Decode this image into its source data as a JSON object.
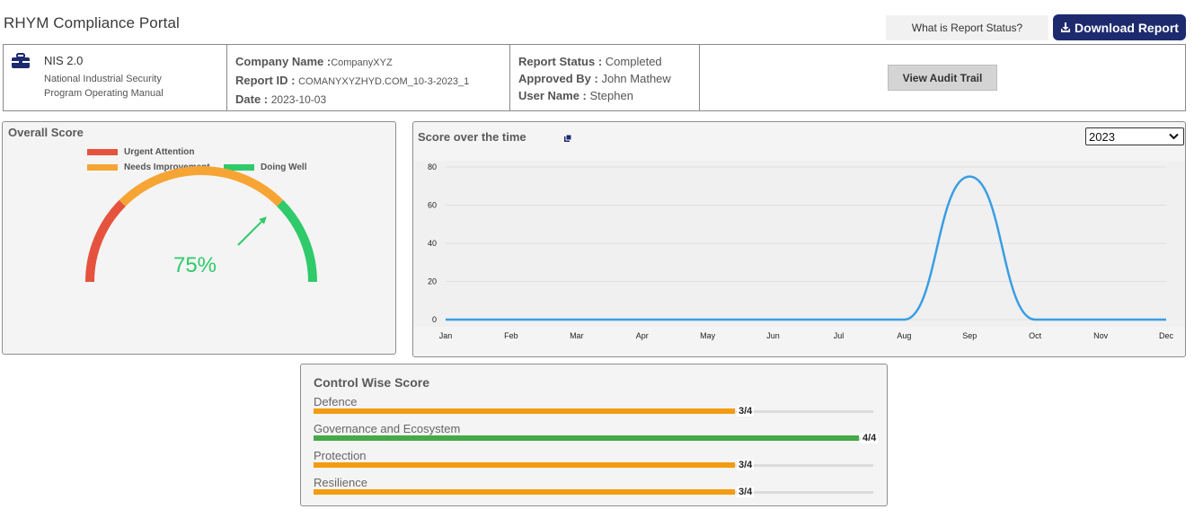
{
  "header": {
    "app_title": "RHYM Compliance Portal",
    "status_button_label": "What is Report Status?",
    "download_button_label": "Download Report",
    "download_icon": "download-icon"
  },
  "info_bar": {
    "framework": {
      "icon": "briefcase-icon",
      "name": "NIS 2.0",
      "description_line1": "National Industrial Security",
      "description_line2": "Program Operating Manual"
    },
    "company": {
      "company_name_label": "Company Name :",
      "company_name_value": "CompanyXYZ",
      "report_id_label": "Report ID :",
      "report_id_value": "COMANYXYZHYD.COM_10-3-2023_1",
      "date_label": "Date :",
      "date_value": "2023-10-03"
    },
    "report": {
      "status_label": "Report Status :",
      "status_value": "Completed",
      "approved_by_label": "Approved By :",
      "approved_by_value": "John Mathew",
      "user_name_label": "User Name :",
      "user_name_value": "Stephen"
    },
    "audit_trail_button_label": "View Audit Trail"
  },
  "overall_score": {
    "title": "Overall Score",
    "legend": [
      {
        "label": "Urgent Attention",
        "color": "#e5533e"
      },
      {
        "label": "Needs Improvement",
        "color": "#f6a535"
      },
      {
        "label": "Doing Well",
        "color": "#2fca6a"
      }
    ],
    "score_text": "75%",
    "score_value": 75,
    "score_color": "#2fca6a"
  },
  "score_over_time": {
    "title": "Score over the time",
    "title_icon": "external-link-icon",
    "year_options": [
      "2023"
    ],
    "selected_year": "2023"
  },
  "chart_data": {
    "type": "line",
    "title": "Score over the time",
    "categories": [
      "Jan",
      "Feb",
      "Mar",
      "Apr",
      "May",
      "Jun",
      "Jul",
      "Aug",
      "Sep",
      "Oct",
      "Nov",
      "Dec"
    ],
    "series": [
      {
        "values": [
          0,
          0,
          0,
          0,
          0,
          0,
          0,
          0,
          75,
          0,
          0,
          0
        ],
        "color": "#3a9ee4"
      }
    ],
    "yticks": [
      0,
      20,
      40,
      60,
      80
    ],
    "ylim": [
      0,
      80
    ],
    "grid": true,
    "xlabel": "",
    "ylabel": ""
  },
  "control_wise_score": {
    "title": "Control Wise Score",
    "items": [
      {
        "label": "Defence",
        "score_text": "3/4",
        "score": 3,
        "max": 4,
        "color": "#f39c12"
      },
      {
        "label": "Governance and Ecosystem",
        "score_text": "4/4",
        "score": 4,
        "max": 4,
        "color": "#47a947"
      },
      {
        "label": "Protection",
        "score_text": "3/4",
        "score": 3,
        "max": 4,
        "color": "#f39c12"
      },
      {
        "label": "Resilience",
        "score_text": "3/4",
        "score": 3,
        "max": 4,
        "color": "#f39c12"
      }
    ]
  }
}
